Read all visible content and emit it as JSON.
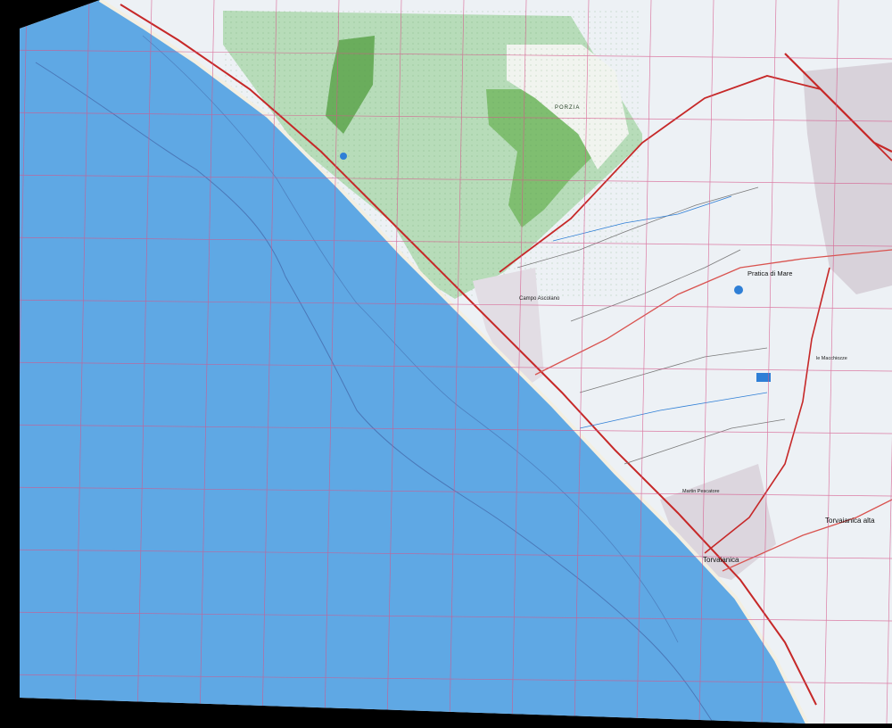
{
  "map": {
    "place_labels": {
      "torvaianica": "Torvaianica",
      "torvaianica_alta": "Torvaianica alta",
      "pratica_di_mare": "Pratica di Mare",
      "campo_ascolano": "Campo Ascolano",
      "martin_pescatore": "Martin Pescatore",
      "le_macchiozze": "le Macchiozze",
      "porzia": "PORZIA"
    },
    "colors": {
      "sea": "#5fa8e4",
      "land": "#edf1f5",
      "forest_light": "#b7dcb9",
      "forest_dark": "#6aad5c",
      "grid": "#d6568a",
      "road_major": "#c62828",
      "road_minor": "#d9534f",
      "built_up": "#8a8a96",
      "track": "#7a7a7a",
      "water_feature": "#2f7fd6",
      "outside_frame": "#000000"
    }
  }
}
